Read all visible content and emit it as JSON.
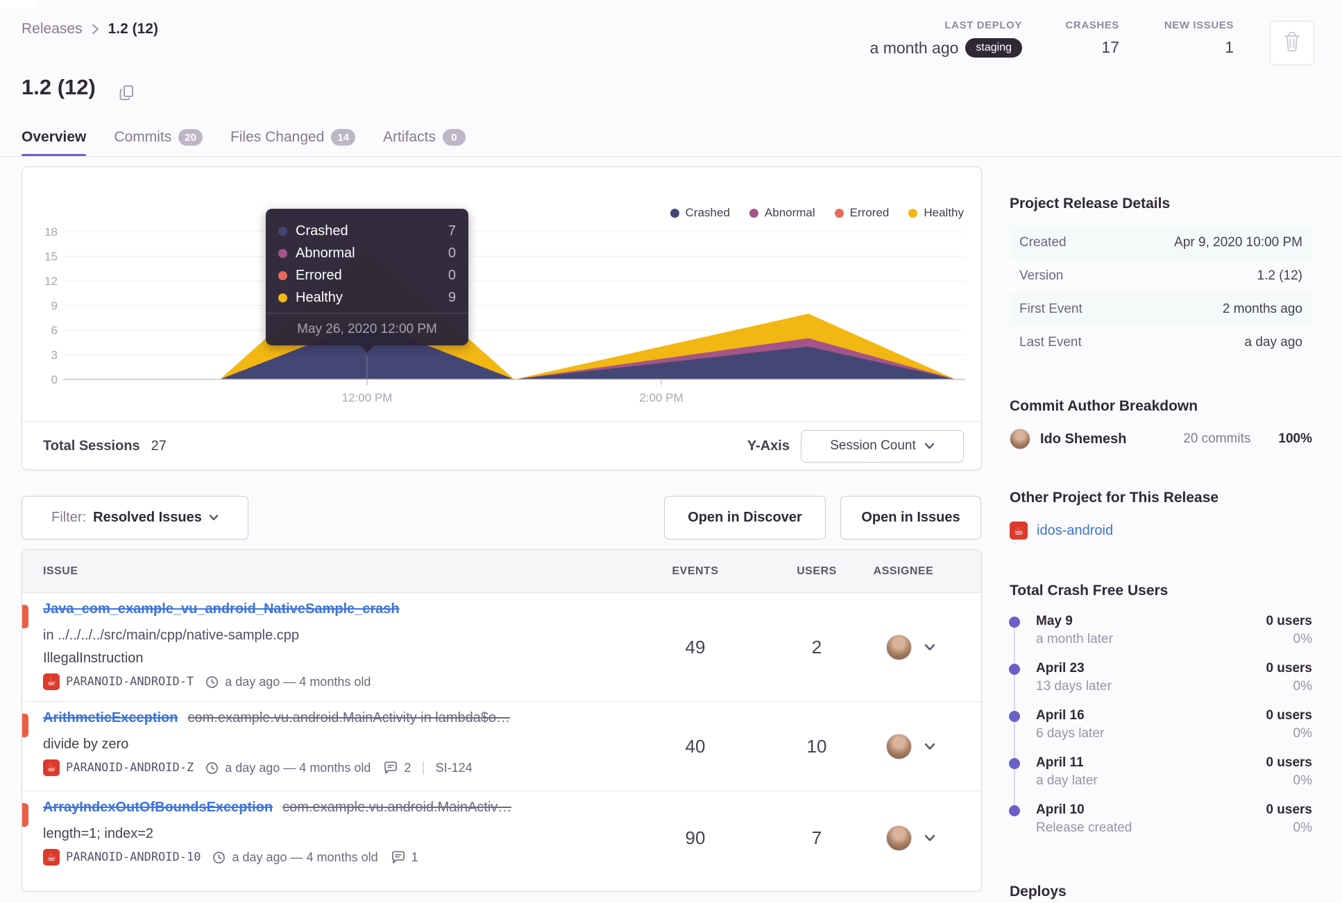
{
  "breadcrumb": {
    "root": "Releases",
    "current": "1.2 (12)"
  },
  "header": {
    "title": "1.2 (12)",
    "stats": [
      {
        "label": "LAST DEPLOY",
        "value": "a month ago",
        "badge": "staging"
      },
      {
        "label": "CRASHES",
        "value": "17"
      },
      {
        "label": "NEW ISSUES",
        "value": "1"
      }
    ]
  },
  "tabs": [
    {
      "label": "Overview"
    },
    {
      "label": "Commits",
      "badge": "20"
    },
    {
      "label": "Files Changed",
      "badge": "14"
    },
    {
      "label": "Artifacts",
      "badge": "0"
    }
  ],
  "chart": {
    "footer": {
      "total_label": "Total Sessions",
      "total_value": "27",
      "yaxis_label": "Y-Axis",
      "yaxis_value": "Session Count"
    }
  },
  "chart_data": {
    "type": "area",
    "stacked": true,
    "grid": true,
    "legend_position": "top-right",
    "ylim": [
      0,
      18
    ],
    "y_ticks": [
      0,
      3,
      6,
      9,
      12,
      15,
      18
    ],
    "x_ticks": [
      {
        "label": "12:00 PM",
        "h": 0
      },
      {
        "label": "2:00 PM",
        "h": 2
      }
    ],
    "series": [
      {
        "name": "Crashed",
        "color": "#444674"
      },
      {
        "name": "Abnormal",
        "color": "#a35488"
      },
      {
        "name": "Errored",
        "color": "#e9695e"
      },
      {
        "name": "Healthy",
        "color": "#f2b712"
      }
    ],
    "points": [
      {
        "h": -2,
        "time": "10:00 AM",
        "values": [
          0,
          0,
          0,
          0
        ]
      },
      {
        "h": -1,
        "time": "11:00 AM",
        "values": [
          0,
          0,
          0,
          0
        ]
      },
      {
        "h": 0,
        "time": "12:00 PM",
        "values": [
          7,
          0,
          0,
          9
        ]
      },
      {
        "h": 1,
        "time": "1:00 PM",
        "values": [
          0,
          0,
          0,
          0
        ]
      },
      {
        "h": 3,
        "time": "3:00 PM",
        "values": [
          4,
          1,
          0,
          3
        ]
      },
      {
        "h": 4,
        "time": "4:00 PM",
        "values": [
          0,
          0,
          0,
          0
        ]
      }
    ],
    "tooltip": {
      "values": [
        "7",
        "0",
        "0",
        "9"
      ],
      "footer": "May 26, 2020 12:00 PM"
    }
  },
  "filter": {
    "label": "Filter:",
    "value": "Resolved Issues"
  },
  "actions": {
    "discover": "Open in Discover",
    "issues": "Open in Issues"
  },
  "issues_table": {
    "columns": {
      "issue": "ISSUE",
      "events": "EVENTS",
      "users": "USERS",
      "assignee": "ASSIGNEE"
    },
    "rows": [
      {
        "title": "Java_com_example_vu_android_NativeSample_crash",
        "path": "in ../../../../src/main/cpp/native-sample.cpp",
        "message": "IllegalInstruction",
        "project": "PARANOID-ANDROID-T",
        "age": "a day ago — 4 months old",
        "events": "49",
        "users": "2"
      },
      {
        "title": "ArithmeticException",
        "culprit": "com.example.vu.android.MainActivity in lambda$o…",
        "message": "divide by zero",
        "project": "PARANOID-ANDROID-Z",
        "age": "a day ago — 4 months old",
        "comments": "2",
        "short_id": "SI-124",
        "events": "40",
        "users": "10"
      },
      {
        "title": "ArrayIndexOutOfBoundsException",
        "culprit": "com.example.vu.android.MainActiv…",
        "message": "length=1; index=2",
        "project": "PARANOID-ANDROID-10",
        "age": "a day ago — 4 months old",
        "comments": "1",
        "events": "90",
        "users": "7"
      }
    ]
  },
  "sidebar": {
    "details": {
      "heading": "Project Release Details",
      "rows": [
        {
          "label": "Created",
          "value": "Apr 9, 2020 10:00 PM"
        },
        {
          "label": "Version",
          "value": "1.2 (12)"
        },
        {
          "label": "First Event",
          "value": "2 months ago"
        },
        {
          "label": "Last Event",
          "value": "a day ago"
        }
      ]
    },
    "authors": {
      "heading": "Commit Author Breakdown",
      "name": "Ido Shemesh",
      "commits": "20 commits",
      "percent": "100%"
    },
    "other_project": {
      "heading": "Other Project for This Release",
      "link": "idos-android"
    },
    "crash_free": {
      "heading": "Total Crash Free Users",
      "items": [
        {
          "date": "May 9",
          "sub": "a month later",
          "users": "0 users",
          "pct": "0%"
        },
        {
          "date": "April 23",
          "sub": "13 days later",
          "users": "0 users",
          "pct": "0%"
        },
        {
          "date": "April 16",
          "sub": "6 days later",
          "users": "0 users",
          "pct": "0%"
        },
        {
          "date": "April 11",
          "sub": "a day later",
          "users": "0 users",
          "pct": "0%"
        },
        {
          "date": "April 10",
          "sub": "Release created",
          "users": "0 users",
          "pct": "0%"
        }
      ]
    },
    "deploys_heading": "Deploys"
  }
}
